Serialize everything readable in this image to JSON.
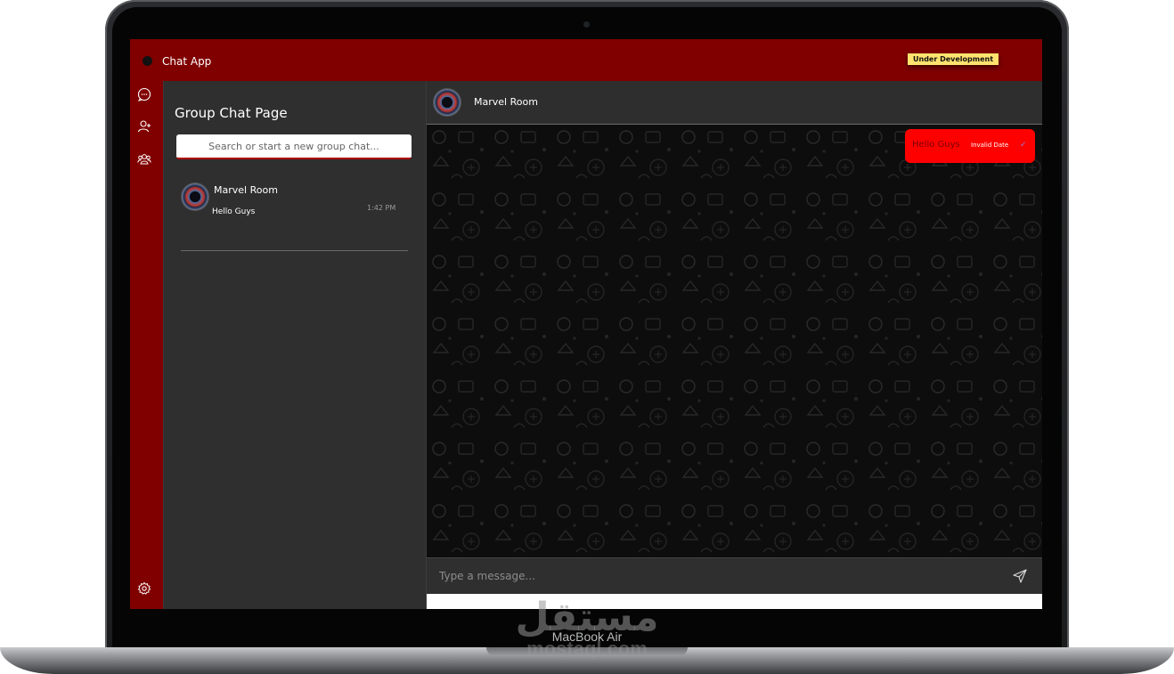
{
  "app": {
    "title": "Chat App",
    "status_badge": "Under Development"
  },
  "rail": {
    "icons": [
      "chat-bubble-icon",
      "add-user-icon",
      "group-icon",
      "settings-icon"
    ]
  },
  "left_panel": {
    "title": "Group Chat Page",
    "search_placeholder": "Search or start a new group chat...",
    "chats": [
      {
        "name": "Marvel Room",
        "last_message": "Hello Guys",
        "time": "1:42 PM"
      }
    ]
  },
  "chat": {
    "room_name": "Marvel Room",
    "messages": [
      {
        "text": "Hello Guys",
        "date": "Invalid Date",
        "status_icon": "check-icon"
      }
    ],
    "composer_placeholder": "Type a message..."
  },
  "device": {
    "model_label": "MacBook Air",
    "watermark_ar": "مستقل",
    "watermark_en": "mostaql.com"
  },
  "colors": {
    "brand": "#800000",
    "badge": "#ffe36e",
    "bubble": "#ff0000",
    "panel": "#2f2f2f",
    "chat_bg": "#0d0d0d"
  }
}
